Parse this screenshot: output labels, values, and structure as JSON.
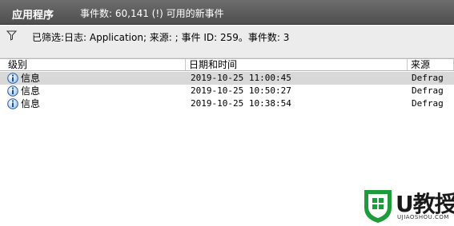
{
  "title_bar": {
    "app_name": "应用程序",
    "event_count": "事件数: 60,141 (!) 可用的新事件"
  },
  "filter": {
    "icon": "funnel-icon",
    "text": "已筛选:日志: Application; 来源: ; 事件 ID: 259。事件数: 3"
  },
  "table": {
    "headers": {
      "level": "级别",
      "date": "日期和时间",
      "source": "来源"
    },
    "rows": [
      {
        "level": "信息",
        "date": "2019-10-25 11:00:45",
        "source": "Defrag",
        "icon": "info-icon"
      },
      {
        "level": "信息",
        "date": "2019-10-25 10:50:27",
        "source": "Defrag",
        "icon": "info-icon"
      },
      {
        "level": "信息",
        "date": "2019-10-25 10:38:54",
        "source": "Defrag",
        "icon": "info-icon"
      }
    ]
  },
  "watermark": {
    "brand": "U教授",
    "url": "UJIAOSHOU.COM"
  },
  "colors": {
    "title_bar": "#5e5e5e",
    "filter_bg": "#ececec",
    "selected_row": "#d8d8d8",
    "brand_green": "#1e9b3a"
  }
}
